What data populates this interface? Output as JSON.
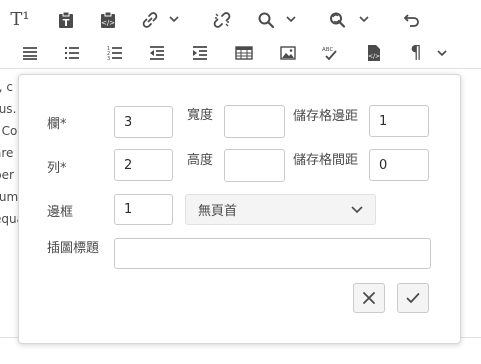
{
  "toolbar": {
    "row1": [
      {
        "icon": "superscript-text-icon",
        "label": "T¹"
      },
      {
        "icon": "paste-plain-text-icon"
      },
      {
        "icon": "paste-from-word-icon"
      },
      {
        "icon": "link-icon"
      },
      {
        "icon": "unlink-icon"
      },
      {
        "icon": "find-icon"
      },
      {
        "icon": "find-replace-icon"
      },
      {
        "icon": "undo-icon"
      }
    ],
    "row2": [
      {
        "icon": "justify-align-icon"
      },
      {
        "icon": "bulleted-list-icon"
      },
      {
        "icon": "numbered-list-icon"
      },
      {
        "icon": "outdent-icon"
      },
      {
        "icon": "indent-icon"
      },
      {
        "icon": "table-icon"
      },
      {
        "icon": "image-icon"
      },
      {
        "icon": "spellcheck-icon",
        "label": "ABC"
      },
      {
        "icon": "source-edit-icon"
      },
      {
        "icon": "paragraph-format-icon",
        "label": "¶"
      }
    ]
  },
  "background_text": [
    "t, c",
    "tus.",
    ". Co",
    "are",
    "per",
    "rum",
    "equa"
  ],
  "dialog": {
    "rows_label": "欄*",
    "rows_value": "3",
    "width_label": "寬度",
    "width_value": "",
    "cell_padding_label": "儲存格邊距",
    "cell_padding_value": "1",
    "columns_label": "列*",
    "columns_value": "2",
    "height_label": "高度",
    "height_value": "",
    "cell_spacing_label": "儲存格間距",
    "cell_spacing_value": "0",
    "border_label": "邊框",
    "border_value": "1",
    "header_select_value": "無頁首",
    "caption_label": "插圖標題",
    "caption_value": ""
  }
}
